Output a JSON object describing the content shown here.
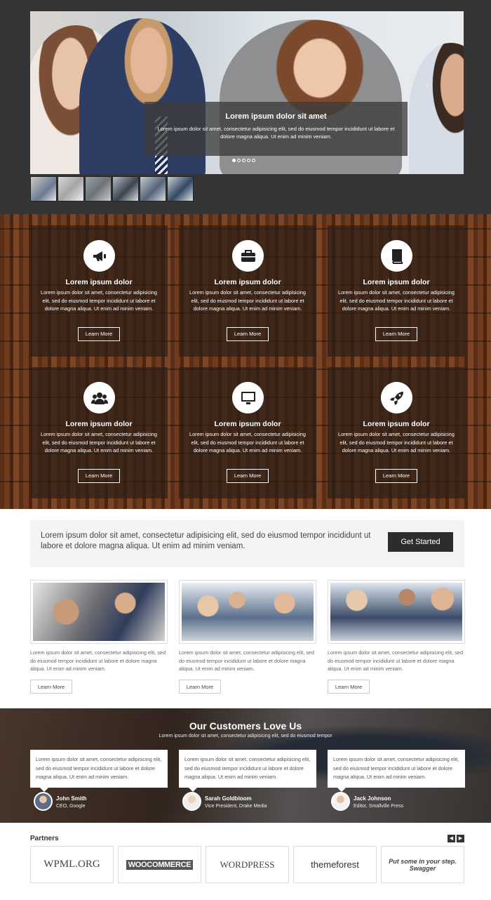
{
  "hero": {
    "caption_title": "Lorem ipsum dolor sit amet",
    "caption_text": "Lorem ipsum dolor sit amet, consectetur adipisicing elit, sed do eiusmod tempor incididunt ut labore et dolore magna aliqua. Ut enim ad minim veniam.",
    "prev_icon": "‹",
    "next_icon": "›"
  },
  "features": [
    {
      "icon": "megaphone-icon",
      "title": "Lorem ipsum dolor",
      "text": "Lorem ipsum dolor sit amet, consectetur adipisicing elit, sed do eiusmod tempor incididunt ut labore et dolore magna aliqua. Ut enim ad minim veniam.",
      "button": "Learn More"
    },
    {
      "icon": "briefcase-icon",
      "title": "Lorem ipsum dolor",
      "text": "Lorem ipsum dolor sit amet, consectetur adipisicing elit, sed do eiusmod tempor incididunt ut labore et dolore magna aliqua. Ut enim ad minim veniam.",
      "button": "Learn More"
    },
    {
      "icon": "book-icon",
      "title": "Lorem ipsum dolor",
      "text": "Lorem ipsum dolor sit amet, consectetur adipisicing elit, sed do eiusmod tempor incididunt ut labore et dolore magna aliqua. Ut enim ad minim veniam.",
      "button": "Learn More"
    },
    {
      "icon": "users-icon",
      "title": "Lorem ipsum dolor",
      "text": "Lorem ipsum dolor sit amet, consectetur adipisicing elit, sed do eiusmod tempor incididunt ut labore et dolore magna aliqua. Ut enim ad minim veniam.",
      "button": "Learn More"
    },
    {
      "icon": "monitor-icon",
      "title": "Lorem ipsum dolor",
      "text": "Lorem ipsum dolor sit amet, consectetur adipisicing elit, sed do eiusmod tempor incididunt ut labore et dolore magna aliqua. Ut enim ad minim veniam.",
      "button": "Learn More"
    },
    {
      "icon": "rocket-icon",
      "title": "Lorem ipsum dolor",
      "text": "Lorem ipsum dolor sit amet, consectetur adipisicing elit, sed do eiusmod tempor incididunt ut labore et dolore magna aliqua. Ut enim ad minim veniam.",
      "button": "Learn More"
    }
  ],
  "cta": {
    "text": "Lorem ipsum dolor sit amet, consectetur adipisicing elit, sed do eiusmod tempor incididunt ut labore et dolore magna aliqua. Ut enim ad minim veniam.",
    "button": "Get Started"
  },
  "articles": [
    {
      "text": "Lorem ipsum dolor sit amet, consectetur adipisicing elit, sed do eiusmod tempor incididunt ut labore et dolore magna aliqua. Ut enim ad minim veniam.",
      "button": "Learn More"
    },
    {
      "text": "Lorem ipsum dolor sit amet, consectetur adipisicing elit, sed do eiusmod tempor incididunt ut labore et dolore magna aliqua. Ut enim ad minim veniam.",
      "button": "Learn More"
    },
    {
      "text": "Lorem ipsum dolor sit amet, consectetur adipisicing elit, sed do eiusmod tempor incididunt ut labore et dolore magna aliqua. Ut enim ad minim veniam.",
      "button": "Learn More"
    }
  ],
  "testimonials": {
    "title": "Our Customers Love Us",
    "subtitle": "Lorem ipsum dolor sit amet, consectetur adipisicing elit, sed do eiusmod tempor",
    "items": [
      {
        "quote": "Lorem ipsum dolor sit amet, consectetur adipisicing elit, sed do eiusmod tempor incididunt ut labore et dolore magna aliqua. Ut enim ad minim veniam.",
        "name": "John Smith",
        "role": "CEO, Google"
      },
      {
        "quote": "Lorem ipsum dolor sit amet, consectetur adipisicing elit, sed do eiusmod tempor incididunt ut labore et dolore magna aliqua. Ut enim ad minim veniam.",
        "name": "Sarah Goldbloom",
        "role": "Vice President, Drake Media"
      },
      {
        "quote": "Lorem ipsum dolor sit amet, consectetur adipisicing elit, sed do eiusmod tempor incididunt ut labore et dolore magna aliqua. Ut enim ad minim veniam.",
        "name": "Jack Johnson",
        "role": "Editor, Smallville Press"
      }
    ]
  },
  "partners": {
    "title": "Partners",
    "prev_icon": "◀",
    "next_icon": "▶",
    "logos": [
      "WPML.ORG",
      "WOOCOMMERCE",
      "WORDPRESS",
      "themeforest",
      "Put some in your step. Swagger"
    ]
  }
}
